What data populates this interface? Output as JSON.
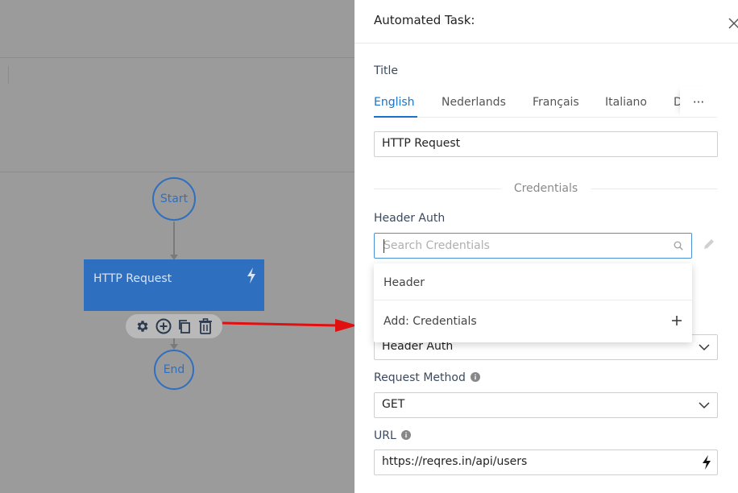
{
  "canvas": {
    "start_label": "Start",
    "task_node_label": "HTTP Request",
    "end_label": "End",
    "toolbar_icons": [
      "gear-icon",
      "plus-circle-icon",
      "copy-icon",
      "trash-icon"
    ]
  },
  "panel": {
    "title": "Automated Task:",
    "title_section_label": "Title",
    "tabs": [
      "English",
      "Nederlands",
      "Français",
      "Italiano",
      "D"
    ],
    "tab_more_label": "···",
    "title_value": "HTTP Request",
    "credentials_divider": "Credentials",
    "header_auth_label": "Header Auth",
    "search_placeholder": "Search Credentials",
    "dropdown_options": [
      "Header",
      "Add: Credentials"
    ],
    "auth_select_value": "Header Auth",
    "request_method_label": "Request Method",
    "request_method_value": "GET",
    "url_label": "URL",
    "url_value": "https://reqres.in/api/users"
  },
  "colors": {
    "accent": "#1a73c8",
    "node_blue": "#2f6fc0",
    "arrow_red": "#e01010"
  }
}
